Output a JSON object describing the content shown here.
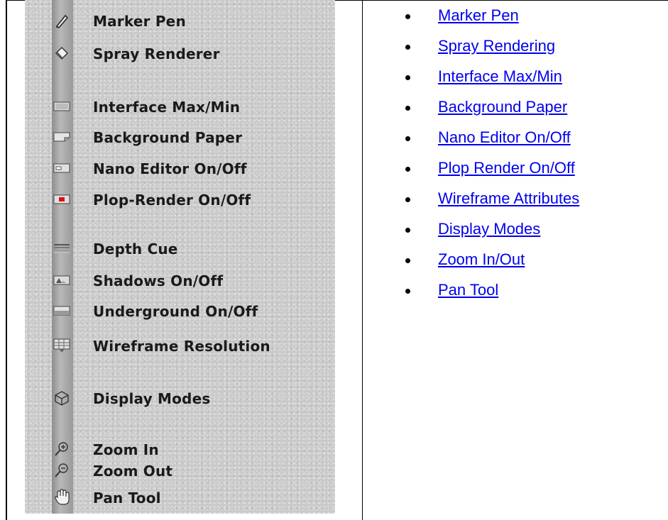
{
  "toolbar": {
    "items": [
      {
        "label": "Marker Pen",
        "icon": "marker-pen-icon"
      },
      {
        "label": "Spray Renderer",
        "icon": "spray-renderer-icon"
      },
      {
        "label": "Interface Max/Min",
        "icon": "interface-max-min-icon"
      },
      {
        "label": "Background Paper",
        "icon": "background-paper-icon"
      },
      {
        "label": "Nano Editor On/Off",
        "icon": "nano-editor-icon"
      },
      {
        "label": "Plop-Render On/Off",
        "icon": "plop-render-icon"
      },
      {
        "label": "Depth Cue",
        "icon": "depth-cue-icon"
      },
      {
        "label": "Shadows On/Off",
        "icon": "shadows-icon"
      },
      {
        "label": "Underground On/Off",
        "icon": "underground-icon"
      },
      {
        "label": "Wireframe Resolution",
        "icon": "wireframe-resolution-icon"
      },
      {
        "label": "Display Modes",
        "icon": "display-modes-icon"
      },
      {
        "label": "Zoom In",
        "icon": "zoom-in-icon"
      },
      {
        "label": "Zoom Out",
        "icon": "zoom-out-icon"
      },
      {
        "label": "Pan Tool",
        "icon": "pan-tool-icon"
      }
    ]
  },
  "links": {
    "items": [
      "Marker Pen",
      "Spray Rendering",
      "Interface Max/Min",
      "Background Paper",
      "Nano Editor On/Off",
      "Plop Render On/Off",
      "Wireframe Attributes",
      "Display Modes",
      "Zoom In/Out",
      "Pan Tool"
    ]
  },
  "colors": {
    "link": "#0000ee",
    "panel": "#c9c9c9",
    "plop_render_red": "#e01010"
  }
}
